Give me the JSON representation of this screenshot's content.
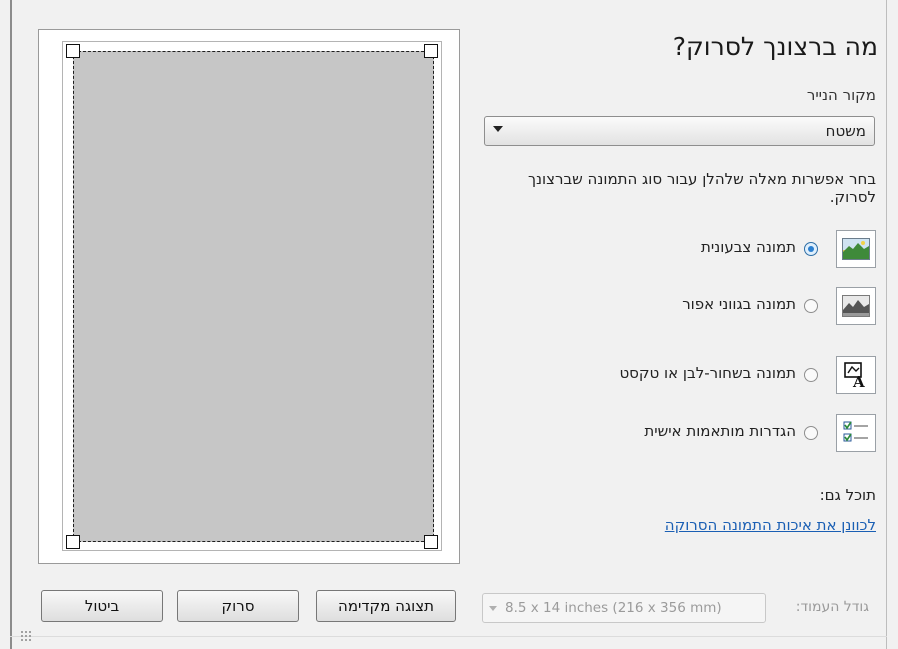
{
  "dialog": {
    "title": "מה ברצונך לסרוק?",
    "paper_source_label": "מקור הנייר",
    "paper_source_value": "משטח",
    "instructions": "בחר אפשרות מאלה שלהלן עבור סוג התמונה שברצונך לסרוק.",
    "options": [
      {
        "label": "תמונה צבעונית",
        "icon": "color-picture-icon",
        "selected": true
      },
      {
        "label": "תמונה בגווני אפור",
        "icon": "grayscale-picture-icon",
        "selected": false
      },
      {
        "label": "תמונה בשחור-לבן או טקסט",
        "icon": "black-white-text-icon",
        "selected": false
      },
      {
        "label": "הגדרות מותאמות אישית",
        "icon": "custom-settings-icon",
        "selected": false
      }
    ],
    "also_label": "תוכל גם:",
    "adjust_link": "לכוונן את איכות התמונה הסרוקה"
  },
  "footer": {
    "page_size_label": "גודל העמוד:",
    "page_size_value": "8.5 x 14 inches (216 x 356 mm)",
    "preview_button": "תצוגה מקדימה",
    "scan_button": "סרוק",
    "cancel_button": "ביטול"
  }
}
